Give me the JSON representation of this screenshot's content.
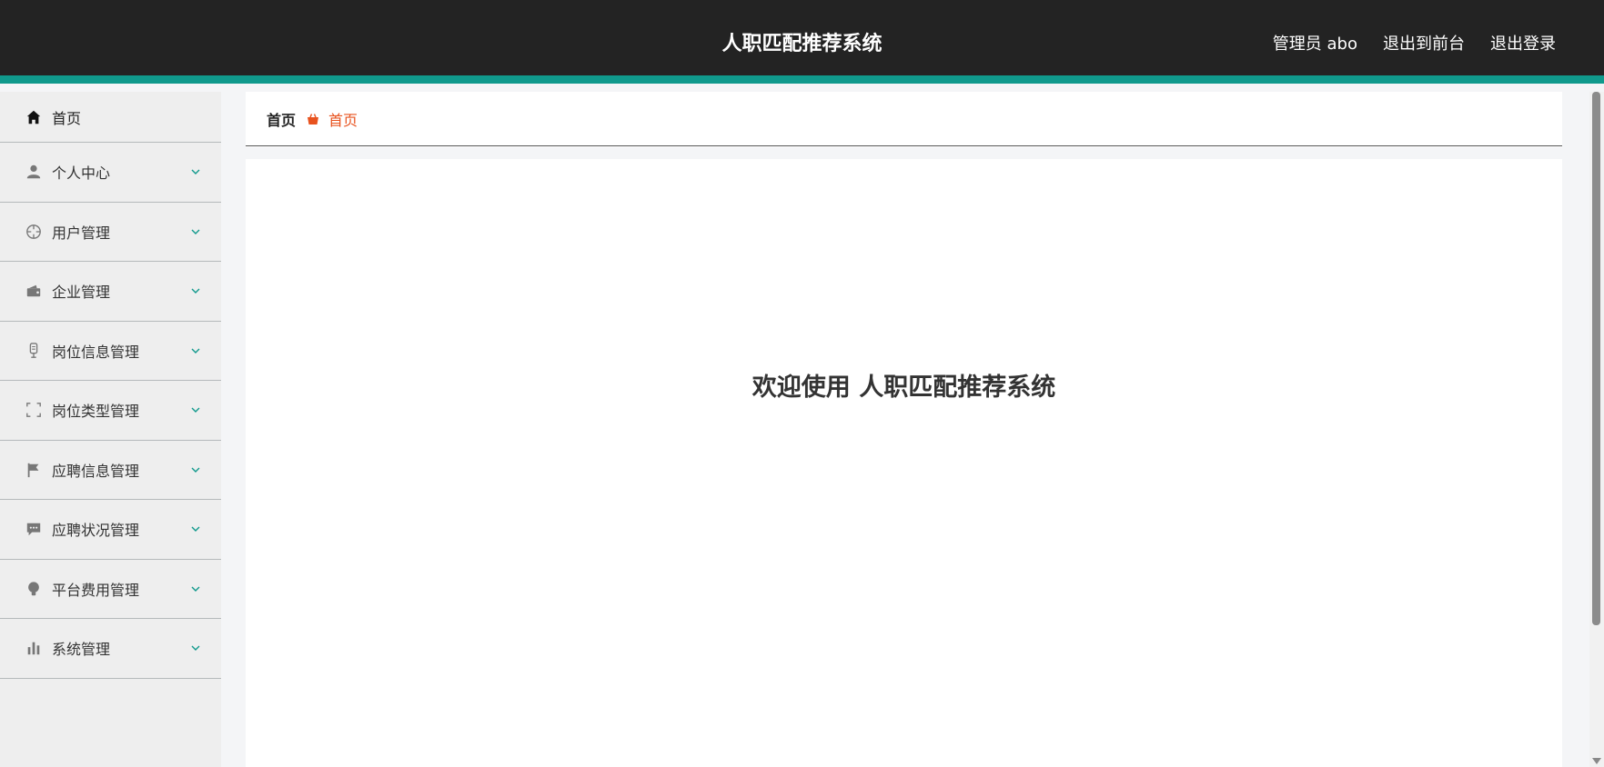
{
  "header": {
    "title": "人职匹配推荐系统",
    "user": "管理员 abo",
    "back_to_front": "退出到前台",
    "logout": "退出登录"
  },
  "colors": {
    "topbar": "#232323",
    "accent_stripe": "#10998c",
    "breadcrumb_current": "#e8521e",
    "sidebar_bg": "#eeeeee"
  },
  "sidebar": {
    "items": [
      {
        "label": "首页",
        "icon": "home-icon"
      },
      {
        "label": "个人中心",
        "icon": "user-icon"
      },
      {
        "label": "用户管理",
        "icon": "crosshair-icon"
      },
      {
        "label": "企业管理",
        "icon": "wallet-icon"
      },
      {
        "label": "岗位信息管理",
        "icon": "microphone-icon"
      },
      {
        "label": "岗位类型管理",
        "icon": "fullscreen-icon"
      },
      {
        "label": "应聘信息管理",
        "icon": "flag-icon"
      },
      {
        "label": "应聘状况管理",
        "icon": "chat-icon"
      },
      {
        "label": "平台费用管理",
        "icon": "bulb-icon"
      },
      {
        "label": "系统管理",
        "icon": "bar-chart-icon"
      }
    ]
  },
  "breadcrumb": {
    "root": "首页",
    "current": "首页"
  },
  "main": {
    "welcome": "欢迎使用 人职匹配推荐系统"
  }
}
